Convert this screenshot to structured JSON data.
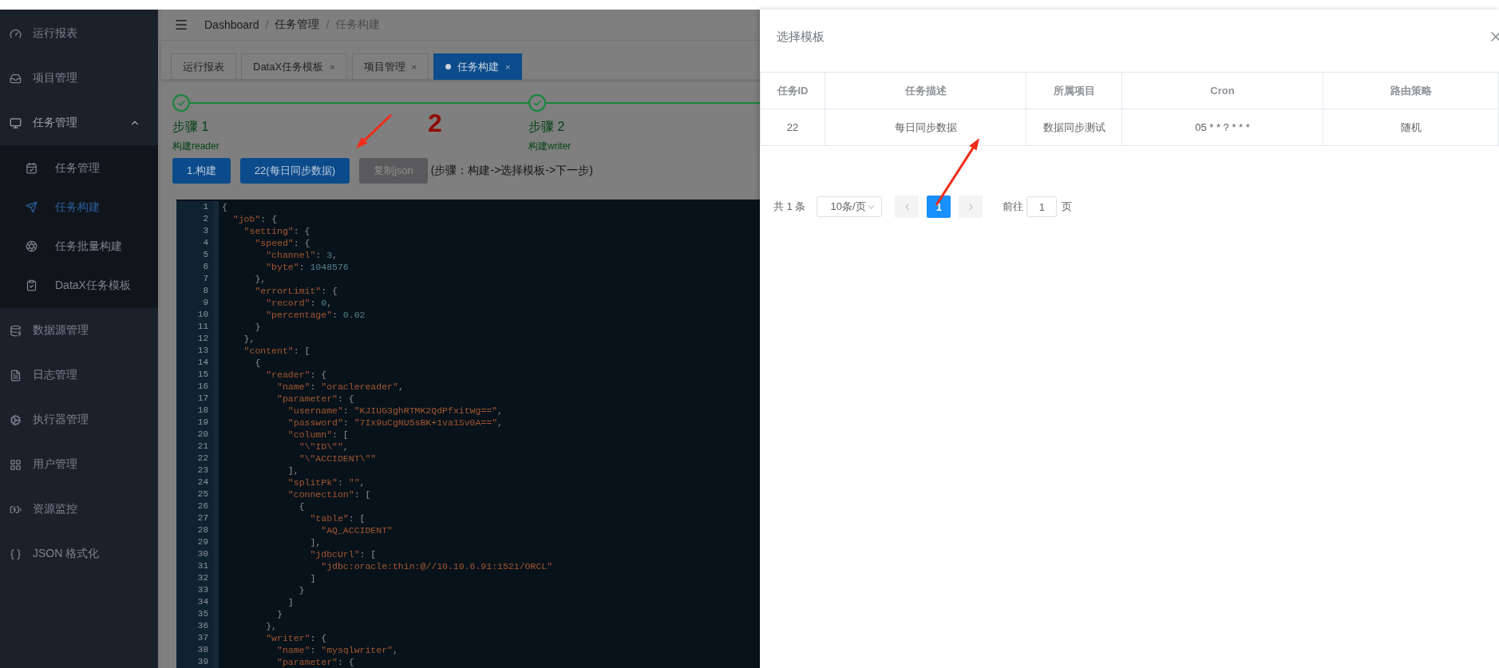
{
  "sidebar": {
    "items": [
      {
        "label": "运行报表",
        "selected": false
      },
      {
        "label": "项目管理",
        "selected": false
      },
      {
        "label": "任务管理",
        "selected": false,
        "expanded": true,
        "children": [
          {
            "label": "任务管理",
            "selected": false
          },
          {
            "label": "任务构建",
            "selected": true
          },
          {
            "label": "任务批量构建",
            "selected": false
          },
          {
            "label": "DataX任务模板",
            "selected": false
          }
        ]
      },
      {
        "label": "数据源管理",
        "selected": false
      },
      {
        "label": "日志管理",
        "selected": false
      },
      {
        "label": "执行器管理",
        "selected": false
      },
      {
        "label": "用户管理",
        "selected": false
      },
      {
        "label": "资源监控",
        "selected": false
      },
      {
        "label": "JSON 格式化",
        "selected": false
      }
    ]
  },
  "breadcrumb": {
    "separator": "/",
    "items": [
      "Dashboard",
      "任务管理",
      "任务构建"
    ]
  },
  "tabs": [
    {
      "label": "运行报表",
      "selected": false,
      "closable": false
    },
    {
      "label": "DataX任务模板",
      "selected": false,
      "closable": true,
      "close": "×"
    },
    {
      "label": "项目管理",
      "selected": false,
      "closable": true,
      "close": "×"
    },
    {
      "label": "任务构建",
      "selected": true,
      "closable": true,
      "close": "×"
    }
  ],
  "steps": [
    {
      "title": "步骤 1",
      "description": "构建reader",
      "done": true
    },
    {
      "title": "步骤 2",
      "description": "构建writer",
      "done": true
    }
  ],
  "actions": [
    {
      "label": "1.构建",
      "disabled": false
    },
    {
      "label": "22(每日同步数据)",
      "disabled": false
    },
    {
      "label": "复制json",
      "disabled": true
    }
  ],
  "hint": "(步骤：构建->选择模板->下一步)",
  "annotation": {
    "number": "2"
  },
  "editor": {
    "lines": [
      {
        "n": "1",
        "code": "{"
      },
      {
        "n": "2",
        "code": "  \"job\": {"
      },
      {
        "n": "3",
        "code": "    \"setting\": {"
      },
      {
        "n": "4",
        "code": "      \"speed\": {"
      },
      {
        "n": "5",
        "code": "        \"channel\": 3,"
      },
      {
        "n": "6",
        "code": "        \"byte\": 1048576"
      },
      {
        "n": "7",
        "code": "      },"
      },
      {
        "n": "8",
        "code": "      \"errorLimit\": {"
      },
      {
        "n": "9",
        "code": "        \"record\": 0,"
      },
      {
        "n": "10",
        "code": "        \"percentage\": 0.02"
      },
      {
        "n": "11",
        "code": "      }"
      },
      {
        "n": "12",
        "code": "    },"
      },
      {
        "n": "13",
        "code": "    \"content\": ["
      },
      {
        "n": "14",
        "code": "      {"
      },
      {
        "n": "15",
        "code": "        \"reader\": {"
      },
      {
        "n": "16",
        "code": "          \"name\": \"oraclereader\","
      },
      {
        "n": "17",
        "code": "          \"parameter\": {"
      },
      {
        "n": "18",
        "code": "            \"username\": \"KJIUG3ghRTMK2QdPfxitWg==\","
      },
      {
        "n": "19",
        "code": "            \"password\": \"7Ix9uCgNU5sBK+1va1Sv0A==\","
      },
      {
        "n": "20",
        "code": "            \"column\": ["
      },
      {
        "n": "21",
        "code": "              \"\\\"ID\\\"\","
      },
      {
        "n": "22",
        "code": "              \"\\\"ACCIDENT\\\"\""
      },
      {
        "n": "23",
        "code": "            ],"
      },
      {
        "n": "24",
        "code": "            \"splitPk\": \"\","
      },
      {
        "n": "25",
        "code": "            \"connection\": ["
      },
      {
        "n": "26",
        "code": "              {"
      },
      {
        "n": "27",
        "code": "                \"table\": ["
      },
      {
        "n": "28",
        "code": "                  \"AQ_ACCIDENT\""
      },
      {
        "n": "29",
        "code": "                ],"
      },
      {
        "n": "30",
        "code": "                \"jdbcUrl\": ["
      },
      {
        "n": "31",
        "code": "                  \"jdbc:oracle:thin:@//10.10.6.91:1521/ORCL\""
      },
      {
        "n": "32",
        "code": "                ]"
      },
      {
        "n": "33",
        "code": "              }"
      },
      {
        "n": "34",
        "code": "            ]"
      },
      {
        "n": "35",
        "code": "          }"
      },
      {
        "n": "36",
        "code": "        },"
      },
      {
        "n": "37",
        "code": "        \"writer\": {"
      },
      {
        "n": "38",
        "code": "          \"name\": \"mysqlwriter\","
      },
      {
        "n": "39",
        "code": "          \"parameter\": {"
      }
    ]
  },
  "drawer": {
    "title": "选择模板",
    "table": {
      "columns": [
        "任务ID",
        "任务描述",
        "所属项目",
        "Cron",
        "路由策略"
      ],
      "rows": [
        [
          "22",
          "每日同步数据",
          "数据同步测试",
          "05 * * ? * * *",
          "随机"
        ]
      ]
    },
    "pagination": {
      "total": "共 1 条",
      "page_size": "10条/页",
      "pages": [
        {
          "label": "1",
          "selected": true
        }
      ],
      "goto_label": "前往",
      "goto_value": "1",
      "goto_suffix": "页"
    }
  }
}
